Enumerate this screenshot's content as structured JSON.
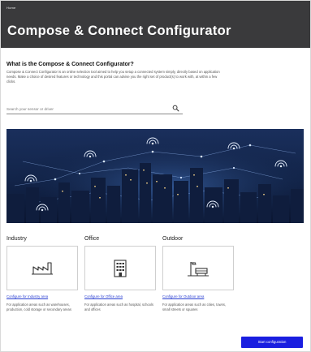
{
  "header": {
    "breadcrumb": "Home",
    "title": "Compose & Connect Configurator"
  },
  "intro": {
    "heading": "What is the Compose & Connect Configurator?",
    "text": "Compose & Connect Configurator is an online selection tool aimed to help you setup a connected system simply, directly based on application needs. Make a choice of desired features or technology and this portal can advise you the right set of product(s) to work with, at within a few clicks."
  },
  "search": {
    "placeholder": "Search your sensor or driver",
    "icon": "search-icon"
  },
  "categories": [
    {
      "label": "Industry",
      "link": "Configure for Industry area",
      "description": "For application areas such as warehouses, production, cold storage or secondary areas",
      "icon": "factory-icon"
    },
    {
      "label": "Office",
      "link": "Configure for Office area",
      "description": "For application areas such as hospital, schools and offices",
      "icon": "office-building-icon"
    },
    {
      "label": "Outdoor",
      "link": "Configure for Outdoor area",
      "description": "For application areas such as cities, towns, small streets or squares",
      "icon": "street-lamp-icon"
    }
  ],
  "actions": {
    "start_label": "Start configuration"
  },
  "colors": {
    "header_bg": "#3a3a3c",
    "accent": "#1a1ee0",
    "link": "#2a3fd1"
  }
}
